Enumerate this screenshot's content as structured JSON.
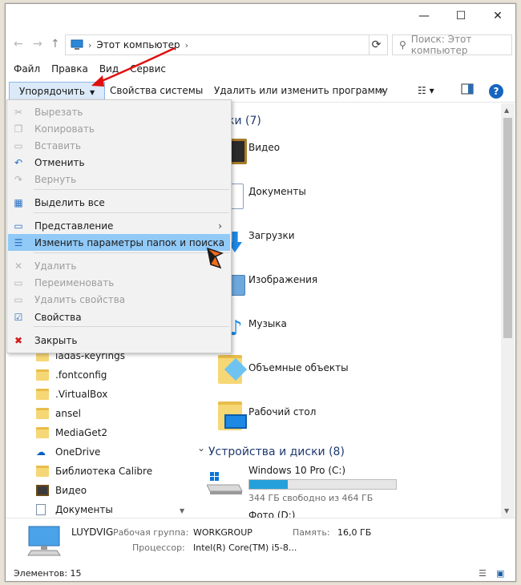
{
  "window": {
    "minimize": "—",
    "maximize": "☐",
    "close": "✕"
  },
  "nav": {
    "back": "←",
    "forward": "→",
    "up": "↑"
  },
  "address": {
    "location": "Этот компьютер",
    "sep1": "›",
    "sep2": "›"
  },
  "search": {
    "placeholder": "Поиск: Этот компьютер"
  },
  "menubar": [
    "Файл",
    "Правка",
    "Вид",
    "Сервис"
  ],
  "toolbar": {
    "organize": "Упорядочить",
    "system_properties": "Свойства системы",
    "uninstall": "Удалить или изменить программу",
    "more": "»",
    "help": "?"
  },
  "dropdown": [
    {
      "label": "Вырезать",
      "disabled": true,
      "icon": "scissors-icon",
      "glyph": "✂"
    },
    {
      "label": "Копировать",
      "disabled": true,
      "icon": "copy-icon",
      "glyph": "❐"
    },
    {
      "label": "Вставить",
      "disabled": true,
      "icon": "paste-icon",
      "glyph": "▭"
    },
    {
      "label": "Отменить",
      "disabled": false,
      "icon": "undo-icon",
      "glyph": "↶"
    },
    {
      "label": "Вернуть",
      "disabled": true,
      "icon": "redo-icon",
      "glyph": "↷"
    },
    {
      "label": "Выделить все",
      "disabled": false,
      "icon": "select-all-icon",
      "glyph": "▦"
    },
    {
      "label": "Представление",
      "disabled": false,
      "icon": "view-icon",
      "glyph": "▭",
      "submenu": "›"
    },
    {
      "label": "Изменить параметры папок и поиска",
      "disabled": false,
      "icon": "folder-options-icon",
      "glyph": "☰",
      "highlighted": true
    },
    {
      "label": "Удалить",
      "disabled": true,
      "icon": "delete-icon",
      "glyph": "✕"
    },
    {
      "label": "Переименовать",
      "disabled": true,
      "icon": "rename-icon",
      "glyph": "▭"
    },
    {
      "label": "Удалить свойства",
      "disabled": true,
      "icon": "remove-properties-icon",
      "glyph": "▭"
    },
    {
      "label": "Свойства",
      "disabled": false,
      "icon": "properties-icon",
      "glyph": "☑"
    },
    {
      "label": "Закрыть",
      "disabled": false,
      "icon": "close-red-icon",
      "glyph": "✖"
    }
  ],
  "tree": [
    {
      "label": "ladas-keyrings",
      "icon": "folder-icon"
    },
    {
      "label": ".fontconfig",
      "icon": "folder-icon"
    },
    {
      "label": ".VirtualBox",
      "icon": "folder-icon"
    },
    {
      "label": "ansel",
      "icon": "folder-icon"
    },
    {
      "label": "MediaGet2",
      "icon": "folder-icon"
    },
    {
      "label": "OneDrive",
      "icon": "onedrive-icon"
    },
    {
      "label": "Библиотека Calibre",
      "icon": "folder-icon"
    },
    {
      "label": "Видео",
      "icon": "video-folder-icon"
    },
    {
      "label": "Документы",
      "icon": "documents-folder-icon"
    }
  ],
  "main": {
    "folders_group": "ки (7)",
    "folders": [
      "Видео",
      "Документы",
      "Загрузки",
      "Изображения",
      "Музыка",
      "Объемные объекты",
      "Рабочий стол"
    ],
    "devices_group": "Устройства и диски (8)",
    "collapse_glyph": "⌄",
    "drive_c_name": "Windows 10 Pro (C:)",
    "drive_c_free": "344 ГБ свободно из 464 ГБ",
    "drive_c_used_fraction": 0.26,
    "drive_d_name": "Фото (D:)"
  },
  "details": {
    "computer": "LUYDVIG",
    "workgroup_label": "Рабочая группа:",
    "workgroup": "WORKGROUP",
    "memory_label": "Память:",
    "memory": "16,0 ГБ",
    "cpu_label": "Процессор:",
    "cpu": "Intel(R) Core(TM) i5-8..."
  },
  "status": {
    "items": "Элементов: 15"
  },
  "colors": {
    "accent": "#0078d7",
    "highlight": "#91c9f7",
    "arrow": "#e01010"
  }
}
